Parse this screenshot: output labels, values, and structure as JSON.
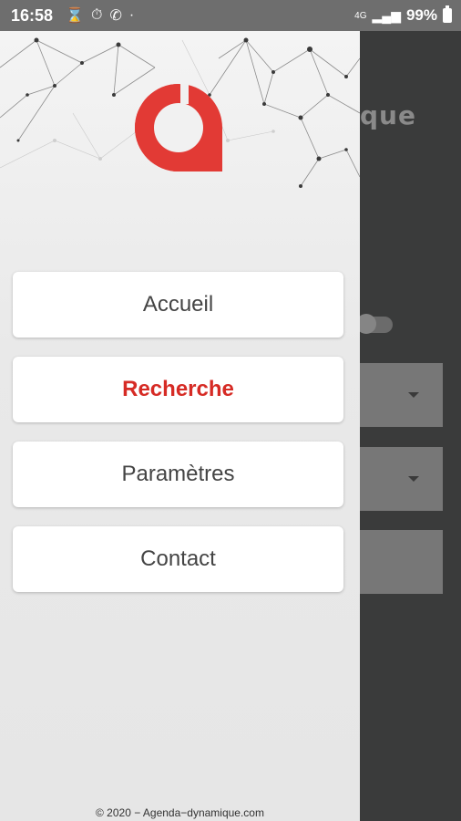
{
  "status_bar": {
    "time": "16:58",
    "left_icons": [
      "hourglass-icon",
      "stopwatch-icon",
      "whatsapp-icon",
      "dot-icon"
    ],
    "network": "4G",
    "battery": "99%"
  },
  "background_app": {
    "title_fragment": "que"
  },
  "drawer": {
    "menu": [
      {
        "label": "Accueil",
        "active": false
      },
      {
        "label": "Recherche",
        "active": true
      },
      {
        "label": "Paramètres",
        "active": false
      },
      {
        "label": "Contact",
        "active": false
      }
    ],
    "footer": "© 2020 − Agenda−dynamique.com"
  },
  "colors": {
    "accent": "#d62b25",
    "drawer_bg": "#ececec",
    "background": "#3a3b3b"
  }
}
